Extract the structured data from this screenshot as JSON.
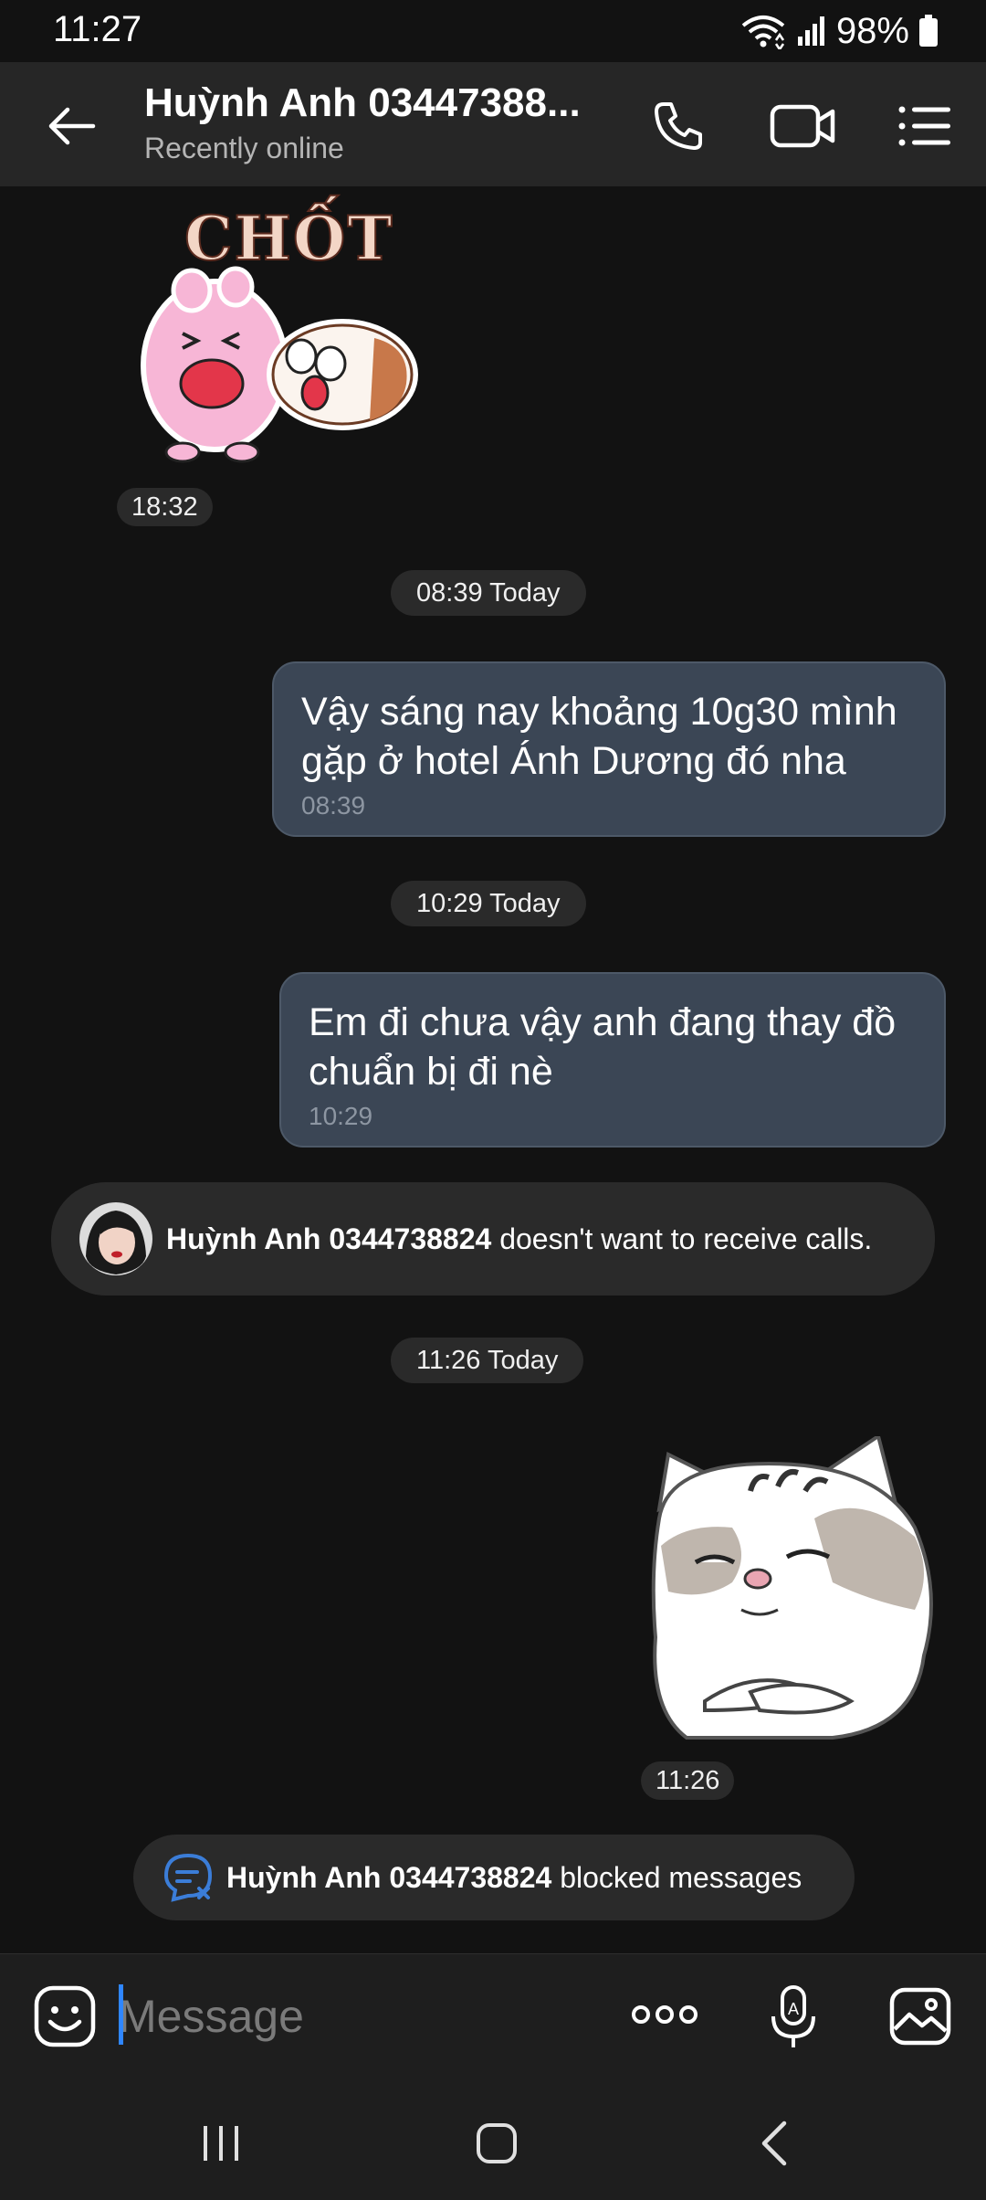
{
  "status_bar": {
    "time": "11:27",
    "battery": "98%",
    "icons": [
      "wifi-icon",
      "signal-icon",
      "battery-icon"
    ]
  },
  "header": {
    "contact_name": "Huỳnh Anh 03447388...",
    "status": "Recently online",
    "icons": [
      "back-arrow-icon",
      "phone-icon",
      "video-icon",
      "menu-list-icon"
    ]
  },
  "messages": {
    "sticker1": {
      "text": "CHỐT",
      "time": "18:32"
    },
    "sep1": "08:39 Today",
    "msg1": {
      "text": "Vậy sáng nay khoảng 10g30 mình gặp ở hotel Ánh Dương đó nha",
      "time": "08:39"
    },
    "sep2": "10:29 Today",
    "msg2": {
      "text": "Em đi chưa vậy anh đang thay đồ chuẩn bị đi nè",
      "time": "10:29"
    },
    "notice_calls": {
      "name": "Huỳnh Anh 0344738824",
      "text": "doesn't want to receive calls."
    },
    "sep3": "11:26 Today",
    "sticker2": {
      "time": "11:26"
    },
    "notice_blocked": {
      "name": "Huỳnh Anh 0344738824",
      "text": "blocked messages"
    }
  },
  "composer": {
    "placeholder": "Message",
    "icons": [
      "emoji-icon",
      "more-icon",
      "voice-icon",
      "gallery-icon"
    ]
  },
  "colors": {
    "background": "#121212",
    "header": "#262626",
    "bubble": "#3b4655",
    "accent": "#2f86ff"
  }
}
